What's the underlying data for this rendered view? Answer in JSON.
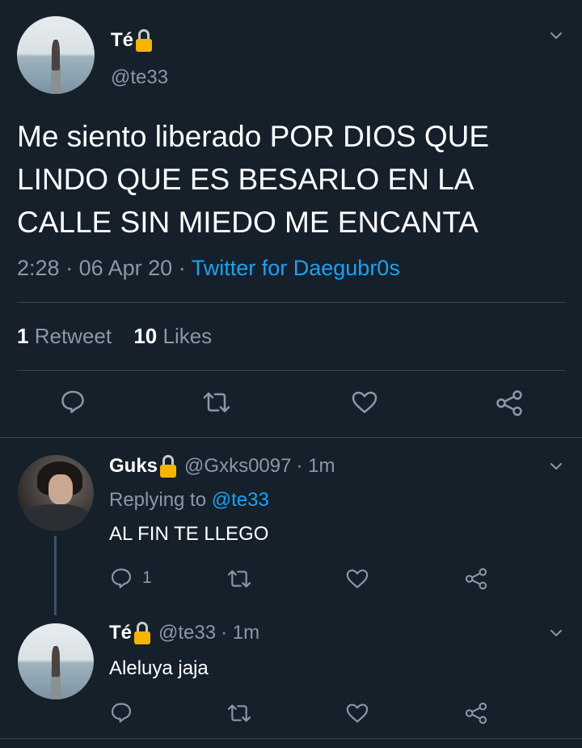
{
  "main_tweet": {
    "author_name": "Té",
    "author_handle": "@te33",
    "text": "Me siento liberado POR DIOS QUE LINDO QUE ES BESARLO EN LA CALLE SIN MIEDO ME ENCANTA",
    "time": "2:28",
    "date": "06 Apr 20",
    "separator": "·",
    "source": "Twitter for Daegubr0s",
    "retweets_count": "1",
    "retweets_label": "Retweet",
    "likes_count": "10",
    "likes_label": "Likes",
    "avatar_icon": "protected-lock-icon"
  },
  "replies": [
    {
      "author_name": "Guks",
      "author_handle": "@Gxks0097",
      "time_ago": "· 1m",
      "replying_label": "Replying to",
      "replying_to": "@te33",
      "text": "AL FIN TE LLEGO",
      "reply_count": "1"
    },
    {
      "author_name": "Té",
      "author_handle": "@te33",
      "time_ago": "· 1m",
      "text": "Aleluya jaja"
    }
  ],
  "colors": {
    "background": "#15202b",
    "text_primary": "#ffffff",
    "text_secondary": "#8899a6",
    "accent": "#1da1f2",
    "divider": "#38444d",
    "lock": "#f4b400"
  }
}
